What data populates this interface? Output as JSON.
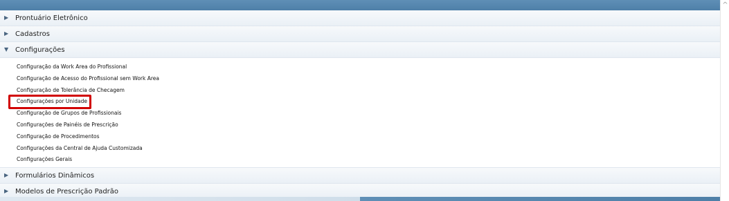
{
  "menu": {
    "sections": [
      {
        "label": "Prontuário Eletrônico",
        "expanded": false
      },
      {
        "label": "Cadastros",
        "expanded": false
      },
      {
        "label": "Configurações",
        "expanded": true,
        "items": [
          "Configuração da Work Area do Profissional",
          "Configuração de Acesso do Profissional sem Work Area",
          "Configuração de Tolerância de Checagem",
          "Configurações por Unidade",
          "Configuração de Grupos de Profissionais",
          "Configurações de Painéis de Prescrição",
          "Configuração de Procedimentos",
          "Configurações da Central de Ajuda Customizada",
          "Configurações Gerais"
        ],
        "highlighted_item": "Configurações por Unidade"
      },
      {
        "label": "Formulários Dinâmicos",
        "expanded": false
      },
      {
        "label": "Modelos de Prescrição Padrão",
        "expanded": false
      }
    ]
  },
  "icons": {
    "collapsed": "triangle-right-icon",
    "expanded": "triangle-down-icon",
    "scroll_up": "chevron-up-icon"
  },
  "colors": {
    "top_bar": "#5f8fb6",
    "highlight_border": "#d10000",
    "header_bg": "#eaf0f6"
  }
}
